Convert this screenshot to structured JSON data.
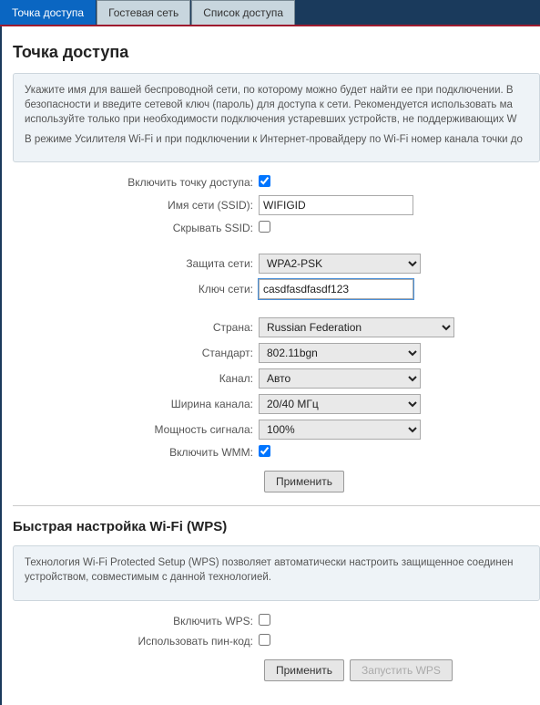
{
  "tabs": {
    "ap": "Точка доступа",
    "guest": "Гостевая сеть",
    "acl": "Список доступа"
  },
  "ap": {
    "heading": "Точка доступа",
    "info1": "Укажите имя для вашей беспроводной сети, по которому можно будет найти ее при подключении. В безопасности и введите сетевой ключ (пароль) для доступа к сети. Рекомендуется использовать ма используйте только при необходимости подключения устаревших устройств, не поддерживающих W",
    "info2": "В режиме Усилителя Wi-Fi и при подключении к Интернет-провайдеру по Wi-Fi номер канала точки до",
    "labels": {
      "enable": "Включить точку доступа:",
      "ssid": "Имя сети (SSID):",
      "hide": "Скрывать SSID:",
      "security": "Защита сети:",
      "key": "Ключ сети:",
      "country": "Страна:",
      "standard": "Стандарт:",
      "channel": "Канал:",
      "width": "Ширина канала:",
      "power": "Мощность сигнала:",
      "wmm": "Включить WMM:"
    },
    "values": {
      "ssid": "WIFIGID",
      "security": "WPA2-PSK",
      "key": "casdfasdfasdf123",
      "country": "Russian Federation",
      "standard": "802.11bgn",
      "channel": "Авто",
      "width": "20/40 МГц",
      "power": "100%"
    },
    "apply": "Применить"
  },
  "wps": {
    "heading": "Быстрая настройка Wi-Fi (WPS)",
    "info": "Технология Wi-Fi Protected Setup (WPS) позволяет автоматически настроить защищенное соединен устройством, совместимым с данной технологией.",
    "labels": {
      "enable": "Включить WPS:",
      "pin": "Использовать пин-код:"
    },
    "apply": "Применить",
    "start": "Запустить WPS"
  }
}
